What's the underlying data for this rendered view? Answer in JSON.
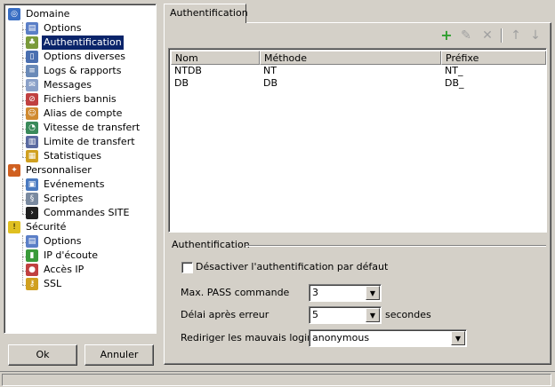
{
  "tree": {
    "domaine": "Domaine",
    "options": "Options",
    "authentification": "Authentification",
    "options_diverses": "Options diverses",
    "logs": "Logs & rapports",
    "messages": "Messages",
    "fichiers_bannis": "Fichiers bannis",
    "alias": "Alias de compte",
    "vitesse": "Vitesse de transfert",
    "limite": "Limite de transfert",
    "statistiques": "Statistiques",
    "personnaliser": "Personnaliser",
    "evenements": "Evénements",
    "scriptes": "Scriptes",
    "commandes_site": "Commandes SITE",
    "securite": "Sécurité",
    "sec_options": "Options",
    "ip_ecoute": "IP d'écoute",
    "acces_ip": "Accès IP",
    "ssl": "SSL"
  },
  "buttons": {
    "ok": "Ok",
    "cancel": "Annuler"
  },
  "tab": {
    "label": "Authentification"
  },
  "toolbar": {
    "add_icon": "plus-icon",
    "edit_icon": "pencil-icon",
    "delete_icon": "x-icon",
    "up_icon": "arrow-up-icon",
    "down_icon": "arrow-down-icon",
    "add_color": "#2e9e2e"
  },
  "grid": {
    "columns": [
      "Nom",
      "Méthode",
      "Préfixe"
    ],
    "rows": [
      [
        "NTDB",
        "NT",
        "NT_"
      ],
      [
        "DB",
        "DB",
        "DB_"
      ]
    ]
  },
  "group": {
    "title": "Authentification",
    "disable_checkbox_label": "Désactiver l'authentification par défaut",
    "disable_checked": false,
    "max_pass_label": "Max. PASS commande",
    "max_pass_value": "3",
    "delay_label": "Délai après erreur",
    "delay_value": "5",
    "delay_unit": "secondes",
    "redirect_label": "Rediriger les mauvais login",
    "redirect_value": "anonymous"
  }
}
